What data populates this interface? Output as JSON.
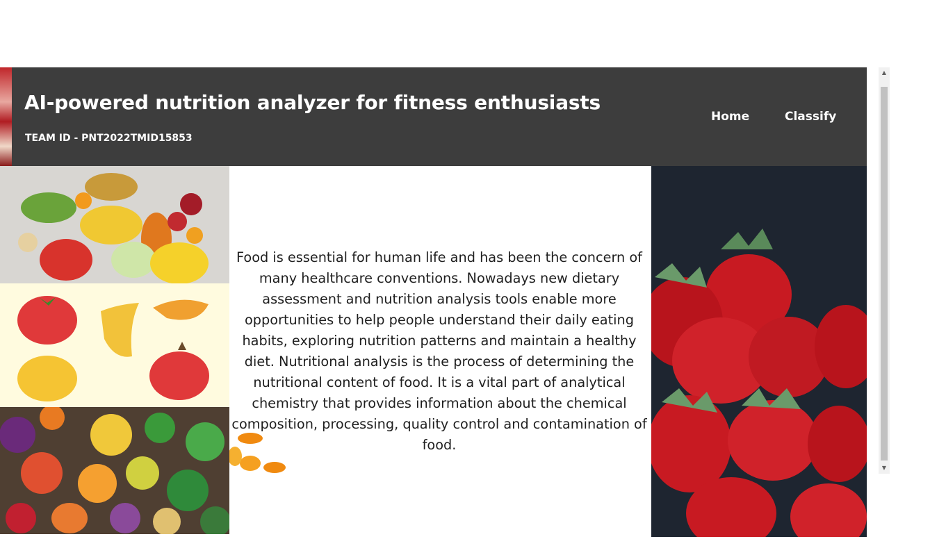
{
  "header": {
    "title": "AI-powered nutrition analyzer for fitness enthusiasts",
    "team_id": "TEAM ID - PNT2022TMID15853",
    "nav": {
      "home": "Home",
      "classify": "Classify"
    }
  },
  "main": {
    "description": "Food is essential for human life and has been the concern of many healthcare conventions. Nowadays new dietary assessment and nutrition analysis tools enable more opportunities to help people understand their daily eating habits, exploring nutrition patterns and maintain a healthy diet. Nutritional analysis is the process of determining the nutritional content of food. It is a vital part of analytical chemistry that provides information about the chemical composition, processing, quality control and contamination of food."
  },
  "images": {
    "fruits_photo": "fruits-photo",
    "cartoon_fruits": "cartoon-fruits-illustration",
    "vegetables_photo": "vegetables-photo",
    "strawberries_photo": "strawberries-photo",
    "orange_slices": "orange-slices-graphic"
  },
  "colors": {
    "header_bg": "#3d3d3d",
    "header_text": "#ffffff",
    "body_text": "#1f1f1f",
    "strawberry_bg": "#1e2530"
  },
  "scrollbar": {
    "up_icon": "arrow-up-icon",
    "down_icon": "arrow-down-icon"
  }
}
